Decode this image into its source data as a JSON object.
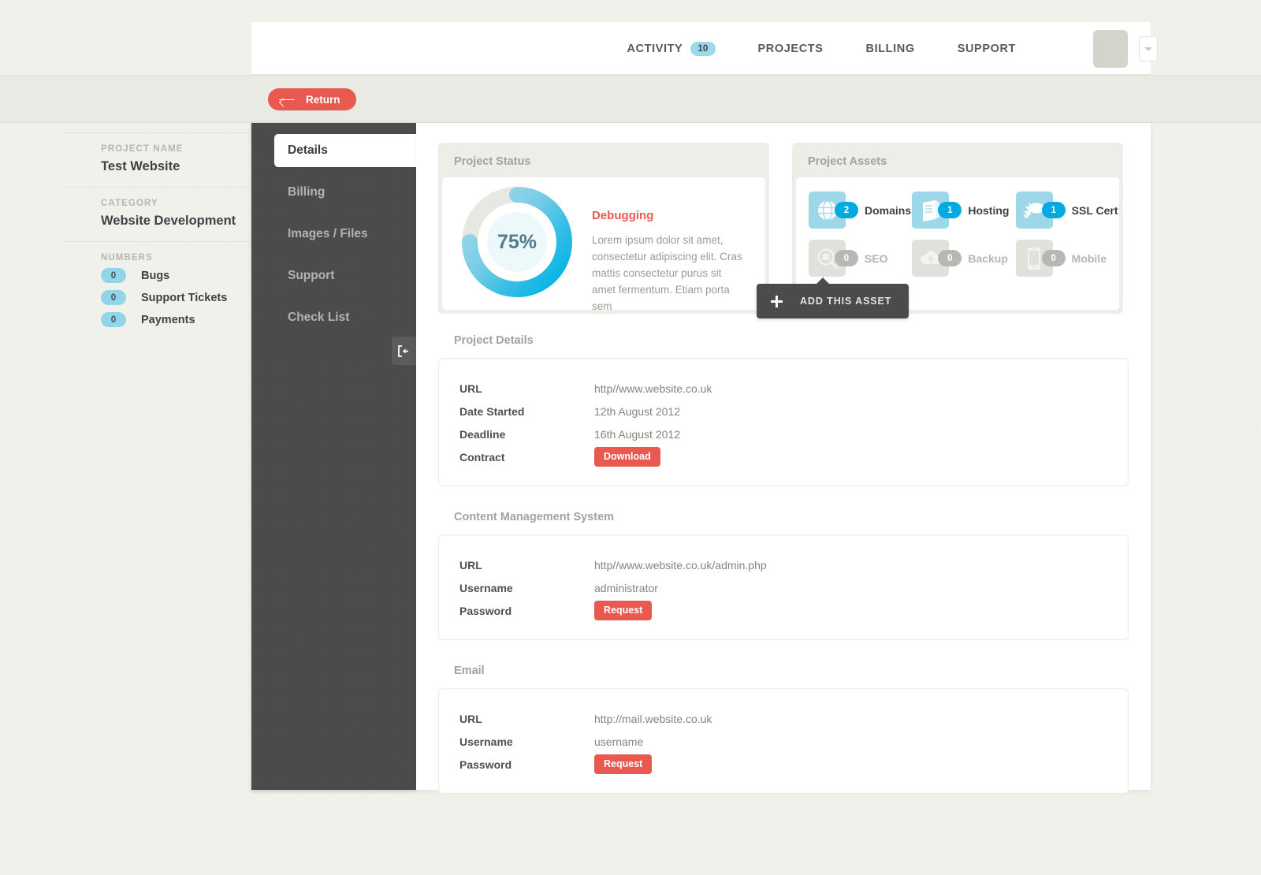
{
  "header": {
    "nav": [
      {
        "label": "ACTIVITY",
        "badge": "10"
      },
      {
        "label": "PROJECTS",
        "badge": null
      },
      {
        "label": "BILLING",
        "badge": null
      },
      {
        "label": "SUPPORT",
        "badge": null
      }
    ]
  },
  "toolbar": {
    "return_label": "Return"
  },
  "sidebar": {
    "project_name_label": "PROJECT NAME",
    "project_name_value": "Test Website",
    "category_label": "CATEGORY",
    "category_value": "Website Development",
    "numbers_label": "NUMBERS",
    "numbers": [
      {
        "count": "0",
        "label": "Bugs"
      },
      {
        "count": "0",
        "label": "Support Tickets"
      },
      {
        "count": "0",
        "label": "Payments"
      }
    ]
  },
  "project_nav": {
    "items": [
      {
        "label": "Details",
        "active": true
      },
      {
        "label": "Billing",
        "active": false
      },
      {
        "label": "Images / Files",
        "active": false
      },
      {
        "label": "Support",
        "active": false
      },
      {
        "label": "Check List",
        "active": false
      }
    ]
  },
  "project_status": {
    "title": "Project Status",
    "percent_label": "75%",
    "percent_value": 75,
    "status": "Debugging",
    "description": "Lorem ipsum dolor sit amet, consectetur adipiscing elit. Cras mattis consectetur purus sit amet fermentum. Etiam porta sem"
  },
  "project_assets": {
    "title": "Project Assets",
    "items": [
      {
        "name": "Domains",
        "count": "2",
        "active": true
      },
      {
        "name": "Hosting",
        "count": "1",
        "active": true
      },
      {
        "name": "SSL Cert",
        "count": "1",
        "active": true
      },
      {
        "name": "SEO",
        "count": "0",
        "active": false
      },
      {
        "name": "Backup",
        "count": "0",
        "active": false
      },
      {
        "name": "Mobile",
        "count": "0",
        "active": false
      }
    ]
  },
  "tooltip": {
    "label": "ADD THIS ASSET"
  },
  "sections": [
    {
      "title": "Project Details",
      "rows": [
        {
          "key": "URL",
          "value": "http//www.website.co.uk",
          "type": "text"
        },
        {
          "key": "Date Started",
          "value": "12th August 2012",
          "type": "text"
        },
        {
          "key": "Deadline",
          "value": "16th August 2012",
          "type": "text"
        },
        {
          "key": "Contract",
          "value": "Download",
          "type": "button"
        }
      ]
    },
    {
      "title": "Content Management System",
      "rows": [
        {
          "key": "URL",
          "value": "http//www.website.co.uk/admin.php",
          "type": "text"
        },
        {
          "key": "Username",
          "value": "administrator",
          "type": "text"
        },
        {
          "key": "Password",
          "value": "Request",
          "type": "button"
        }
      ]
    },
    {
      "title": "Email",
      "rows": [
        {
          "key": "URL",
          "value": "http://mail.website.co.uk",
          "type": "text"
        },
        {
          "key": "Username",
          "value": "username",
          "type": "text"
        },
        {
          "key": "Password",
          "value": "Request",
          "type": "button"
        }
      ]
    }
  ],
  "colors": {
    "accent_red": "#e9594f",
    "accent_blue": "#00a9e0",
    "light_blue": "#9dd7e8",
    "dark_panel": "#4b4b4b",
    "page_bg": "#f1f1ec"
  }
}
